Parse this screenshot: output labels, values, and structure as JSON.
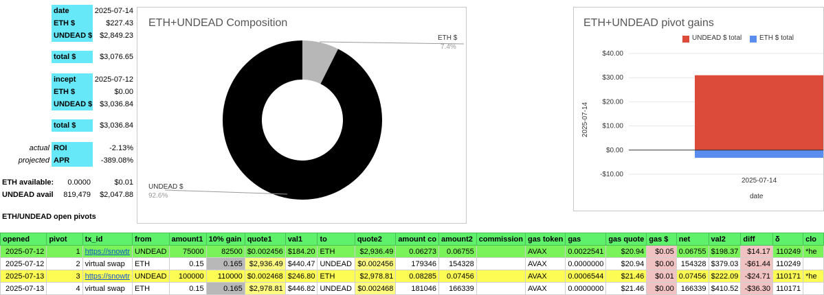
{
  "summary": {
    "date_label": "date",
    "date_value": "2025-07-14",
    "eth_label": "ETH $",
    "eth_value": "$227.43",
    "undead_label": "UNDEAD $",
    "undead_value": "$2,849.23",
    "total_label": "total $",
    "total_value": "$3,076.65",
    "incept_label": "incept",
    "incept_value": "2025-07-12",
    "incept_eth_label": "ETH $",
    "incept_eth_value": "$0.00",
    "incept_undead_label": "UNDEAD $",
    "incept_undead_value": "$3,036.84",
    "incept_total_label": "total $",
    "incept_total_value": "$3,036.84",
    "actual_label": "actual",
    "roi_label": "ROI",
    "roi_value": "-2.13%",
    "projected_label": "projected",
    "apr_label": "APR",
    "apr_value": "-389.08%",
    "eth_avail_label": "ETH available:",
    "eth_avail_amount": "0.0000",
    "eth_avail_value": "$0.01",
    "undead_avail_label": "UNDEAD avail",
    "undead_avail_amount": "819,479",
    "undead_avail_value": "$2,047.88",
    "section_label_a": "ETH/UNDEAD",
    "section_label_b": "open pivots"
  },
  "chart_data": [
    {
      "type": "pie",
      "title": "ETH+UNDEAD Composition",
      "labels": [
        "ETH $",
        "UNDEAD $"
      ],
      "values": [
        7.4,
        92.6
      ],
      "value_labels": [
        "7.4%",
        "92.6%"
      ],
      "colors": [
        "#b7b7b7",
        "#000000"
      ],
      "donut": true
    },
    {
      "type": "bar",
      "title": "ETH+UNDEAD pivot gains",
      "categories": [
        "2025-07-14"
      ],
      "series": [
        {
          "name": "UNDEAD $ total",
          "values": [
            31.0
          ],
          "color": "#dc4b3a"
        },
        {
          "name": "ETH $ total",
          "values": [
            -3.2
          ],
          "color": "#5b8def"
        }
      ],
      "xlabel": "date",
      "ylabel": "2025-07-14",
      "ylim": [
        -10,
        40
      ],
      "yticks": [
        "$40.00",
        "$30.00",
        "$20.00",
        "$10.00",
        "$0.00",
        "-$10.00"
      ],
      "ytick_values": [
        40,
        30,
        20,
        10,
        0,
        -10
      ],
      "stacked": true,
      "legend": "top"
    }
  ],
  "table": {
    "headers": [
      "opened",
      "pivot",
      "tx_id",
      "from",
      "amount1",
      "10% gain",
      "quote1",
      "val1",
      "to",
      "quote2",
      "amount co",
      "amount2",
      "commission",
      "gas token",
      "gas",
      "gas quote",
      "gas $",
      "net",
      "val2",
      "diff",
      "δ",
      "clo"
    ],
    "rows": [
      {
        "style": "green",
        "cells": [
          "2025-07-12",
          "1",
          "https://snowtr",
          "UNDEAD",
          "75000",
          "82500",
          "$0.002456",
          "$184.20",
          "ETH",
          "$2,936.49",
          "0.06273",
          "0.06755",
          "",
          "AVAX",
          "0.0022541",
          "$20.94",
          "$0.05",
          "0.06755",
          "$198.37",
          "$14.17",
          "110249",
          "*he"
        ]
      },
      {
        "style": "white",
        "cells": [
          "2025-07-12",
          "2",
          "virtual swap",
          "ETH",
          "0.15",
          "0.165",
          "$2,936.49",
          "$440.47",
          "UNDEAD",
          "$0.002456",
          "179346",
          "154328",
          "",
          "AVAX",
          "0.0000000",
          "$20.94",
          "$0.00",
          "154328",
          "$379.03",
          "-$61.44",
          "110249",
          ""
        ]
      },
      {
        "style": "yellow",
        "cells": [
          "2025-07-13",
          "3",
          "https://snowtr",
          "UNDEAD",
          "100000",
          "110000",
          "$0.002468",
          "$246.80",
          "ETH",
          "$2,978.81",
          "0.08285",
          "0.07456",
          "",
          "AVAX",
          "0.0006544",
          "$21.46",
          "$0.01",
          "0.07456",
          "$222.09",
          "-$24.71",
          "110171",
          "*he"
        ]
      },
      {
        "style": "white",
        "cells": [
          "2025-07-13",
          "4",
          "virtual swap",
          "ETH",
          "0.15",
          "0.165",
          "$2,978.81",
          "$446.82",
          "UNDEAD",
          "$0.002468",
          "181046",
          "166339",
          "",
          "AVAX",
          "0.0000000",
          "$21.46",
          "$0.00",
          "166339",
          "$410.52",
          "-$36.30",
          "110171",
          ""
        ]
      }
    ]
  }
}
